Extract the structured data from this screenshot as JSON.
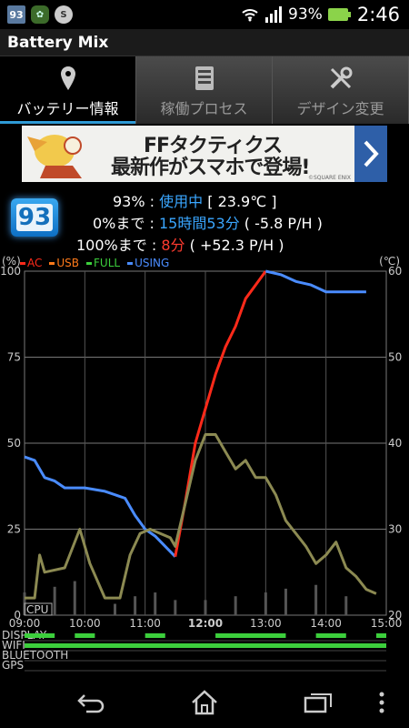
{
  "status_bar": {
    "notif_battery": "93",
    "battery_percent": "93%",
    "time": "2:46",
    "icons": [
      "battery-mix-notification-icon",
      "mix-app-icon",
      "s-app-icon",
      "wifi-icon",
      "signal-icon",
      "battery-icon"
    ]
  },
  "app": {
    "title": "Battery Mix"
  },
  "tabs": [
    {
      "label": "バッテリー情報",
      "icon": "location-pin-icon",
      "active": true
    },
    {
      "label": "稼働プロセス",
      "icon": "list-icon",
      "active": false
    },
    {
      "label": "デザイン変更",
      "icon": "tools-icon",
      "active": false
    }
  ],
  "ad": {
    "line1": "FFタクティクス",
    "line2": "最新作がスマホで登場!",
    "copyright": "©SQUARE ENIX"
  },
  "battery": {
    "badge": "93",
    "row1_label": "93%",
    "row1_sep": ":",
    "row1_state": "使用中",
    "row1_temp": "[ 23.9℃ ]",
    "row2_label": "0%まで",
    "row2_sep": ":",
    "row2_time": "15時間53分",
    "row2_rate": "( -5.8 P/H )",
    "row3_label": "100%まで",
    "row3_sep": ":",
    "row3_time": "8分",
    "row3_rate": "( +52.3 P/H )"
  },
  "legend": {
    "unit_left": "(%)",
    "unit_right": "(℃)",
    "items": [
      {
        "label": "AC",
        "color": "#ff2a1a"
      },
      {
        "label": "USB",
        "color": "#ff7a1a"
      },
      {
        "label": "FULL",
        "color": "#3ccf3c"
      },
      {
        "label": "USING",
        "color": "#4a8cff"
      }
    ]
  },
  "chart_data": {
    "type": "line",
    "x_ticks": [
      "09:00",
      "10:00",
      "11:00",
      "12:00",
      "13:00",
      "14:00",
      "15:00"
    ],
    "x_range": [
      "09:00",
      "15:00"
    ],
    "y_left_ticks": [
      "0",
      "25",
      "50",
      "75",
      "100"
    ],
    "y_left_range": [
      0,
      100
    ],
    "y_right_ticks": [
      "20",
      "30",
      "40",
      "50",
      "60"
    ],
    "y_right_range": [
      20,
      60
    ],
    "cpu_label": "CPU",
    "status_rows": [
      "DISPLAY",
      "WIFI",
      "BLUETOOTH",
      "GPS"
    ],
    "series": [
      {
        "axis": "left",
        "color": "#4a8cff",
        "x": [
          "09:00",
          "09:10",
          "09:20",
          "09:30",
          "09:40",
          "10:00",
          "10:20",
          "10:40",
          "10:50",
          "11:00",
          "11:10",
          "11:20",
          "11:30"
        ],
        "values": [
          46,
          45,
          40,
          39,
          37,
          37,
          36,
          34,
          29,
          25,
          23,
          20,
          17
        ]
      },
      {
        "axis": "left",
        "color": "#ff2a1a",
        "x": [
          "11:30",
          "11:40",
          "11:50",
          "12:00",
          "12:10",
          "12:20",
          "12:30",
          "12:40",
          "12:50",
          "13:00"
        ],
        "values": [
          17,
          33,
          50,
          60,
          70,
          78,
          84,
          92,
          96,
          100
        ]
      },
      {
        "axis": "left",
        "color": "#4a8cff",
        "x": [
          "13:00",
          "13:15",
          "13:30",
          "13:45",
          "14:00",
          "14:20",
          "14:40"
        ],
        "values": [
          100,
          99,
          97,
          96,
          94,
          94,
          94
        ]
      },
      {
        "axis": "right",
        "color": "#8c8a52",
        "x": [
          "09:00",
          "09:10",
          "09:15",
          "09:20",
          "09:40",
          "09:55",
          "10:05",
          "10:20",
          "10:35",
          "10:45",
          "10:55",
          "11:05",
          "11:15",
          "11:25",
          "11:30",
          "11:40",
          "11:50",
          "12:00",
          "12:10",
          "12:20",
          "12:30",
          "12:40",
          "12:50",
          "13:00",
          "13:10",
          "13:20",
          "13:30",
          "13:40",
          "13:50",
          "14:00",
          "14:10",
          "14:20",
          "14:30",
          "14:40",
          "14:50"
        ],
        "values": [
          22,
          22,
          27,
          25,
          25.5,
          30,
          26,
          22,
          22,
          27,
          29.5,
          30,
          29.5,
          29,
          28,
          33,
          38,
          41,
          41,
          39,
          37,
          38,
          36,
          36,
          34,
          31,
          29.5,
          28,
          26,
          27,
          28.5,
          25.5,
          24.5,
          23,
          22.5
        ]
      }
    ],
    "cpu_bars": {
      "x": [
        "09:00",
        "09:30",
        "09:50",
        "10:30",
        "10:50",
        "11:10",
        "11:30",
        "12:00",
        "12:30",
        "13:00",
        "13:20",
        "13:50",
        "14:20"
      ],
      "values": [
        0.12,
        0.15,
        0.18,
        0.06,
        0.1,
        0.12,
        0.08,
        0.08,
        0.1,
        0.12,
        0.14,
        0.16,
        0.1
      ]
    },
    "status_segments": {
      "DISPLAY": [
        [
          "09:00",
          "09:30"
        ],
        [
          "09:50",
          "10:10"
        ],
        [
          "11:00",
          "11:20"
        ],
        [
          "12:10",
          "13:20"
        ],
        [
          "13:50",
          "14:20"
        ],
        [
          "14:50",
          "15:00"
        ]
      ],
      "WIFI": [
        [
          "09:00",
          "15:00"
        ]
      ],
      "BLUETOOTH": [],
      "GPS": []
    }
  }
}
